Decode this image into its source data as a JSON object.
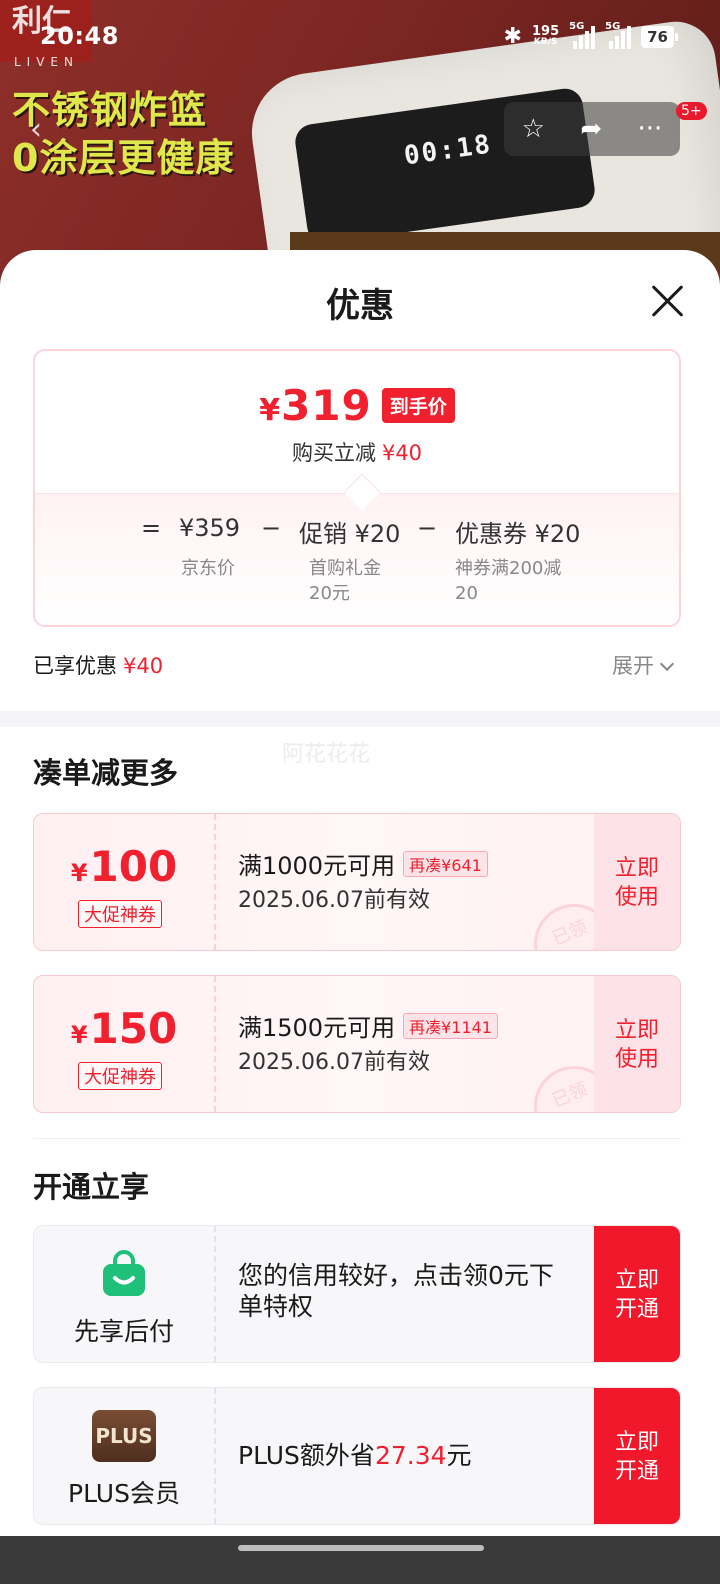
{
  "status_bar": {
    "time": "20:48",
    "net_speed": "195",
    "net_unit": "KB/S",
    "signal1": "5G",
    "signal2": "5G",
    "battery": "76"
  },
  "hero": {
    "brand_logo": "利仁",
    "brand_logo_sub": "LIVEN",
    "promo_line1": "不锈钢炸篮",
    "promo_line2": "0涂层更健康",
    "fryer_display": "00:18",
    "badge_count": "5+"
  },
  "sheet": {
    "title": "优惠",
    "price": {
      "currency": "¥",
      "final_amount": "319",
      "final_tag": "到手价",
      "save_label": "购买立减",
      "save_value": "¥40",
      "equals": "=",
      "jd_price": "¥359",
      "minus1": "−",
      "promo_item": "促销 ¥20",
      "minus2": "−",
      "coupon_item": "优惠券 ¥20",
      "jd_price_label": "京东价",
      "promo_sub": "首购礼金\n20元",
      "coupon_sub": "神券满200减\n20"
    },
    "enjoyed_label": "已享优惠",
    "enjoyed_value": "¥40",
    "expand_label": "展开",
    "watermark": "阿花花花",
    "section_more": "凑单减更多",
    "coupons": [
      {
        "currency": "¥",
        "amount": "100",
        "type": "大促神券",
        "condition": "满1000元可用",
        "more": "再凑¥641",
        "valid": "2025.06.07前有效",
        "use": "立即\n使用",
        "stamp": "已领"
      },
      {
        "currency": "¥",
        "amount": "150",
        "type": "大促神券",
        "condition": "满1500元可用",
        "more": "再凑¥1141",
        "valid": "2025.06.07前有效",
        "use": "立即\n使用",
        "stamp": "已领"
      }
    ],
    "section_open": "开通立享",
    "services": [
      {
        "name": "先享后付",
        "desc": "您的信用较好，点击领0元下单特权",
        "action": "立即\n开通"
      },
      {
        "name": "PLUS会员",
        "icon_text": "PLUS",
        "desc_prefix": "PLUS额外省",
        "desc_value": "27.34",
        "desc_suffix": "元",
        "action": "立即\n开通"
      }
    ]
  },
  "colors": {
    "accent_red": "#f0202e",
    "coupon_bg": "#fff0f2",
    "service_bg": "#f7f7fa"
  }
}
